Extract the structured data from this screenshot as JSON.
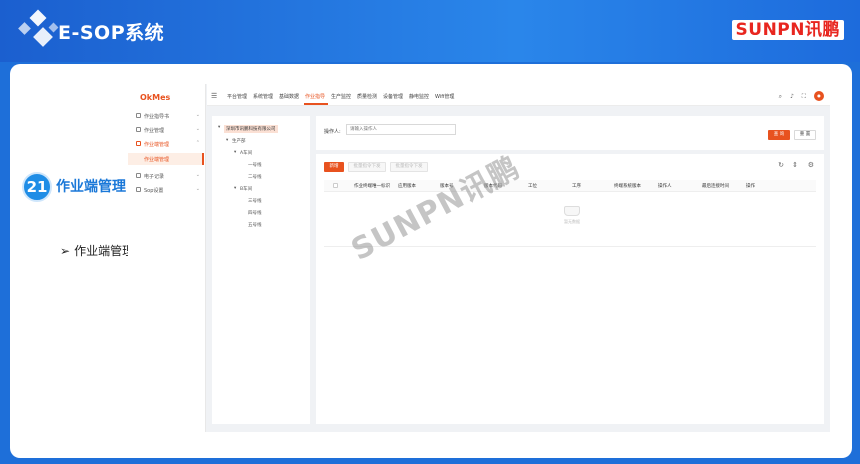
{
  "header": {
    "title": "E-SOP系统",
    "brand": "SUNPN讯鹏"
  },
  "section": {
    "number": "21",
    "title": "作业端管理",
    "bullet": "作业端管理"
  },
  "app": {
    "logo": "OkMes",
    "sidebar": [
      {
        "label": "作业指导书",
        "icon": "book-icon",
        "active": false
      },
      {
        "label": "作业管理",
        "icon": "list-icon",
        "active": false
      },
      {
        "label": "作业端管理",
        "icon": "device-icon",
        "active": true
      },
      {
        "label": "电子记录",
        "icon": "record-icon",
        "active": false
      },
      {
        "label": "Sop设置",
        "icon": "gear-icon",
        "active": false
      }
    ],
    "sidebar_sub": "作业端管理",
    "nav_tabs": [
      "平台管理",
      "系统管理",
      "基础数据",
      "作业指导",
      "生产监控",
      "质量检测",
      "设备管理",
      "静电监控",
      "Wifi管理"
    ],
    "nav_active": "作业指导",
    "tree": {
      "root": "深圳市讯鹏科技有限公司",
      "dept": "生产部",
      "workshop_a": "A车间",
      "lines_a": [
        "一号线",
        "二号线"
      ],
      "workshop_b": "B车间",
      "lines_b": [
        "三号线",
        "四号线",
        "五号线"
      ]
    },
    "filter": {
      "label": "操作人:",
      "placeholder": "请输入操作人",
      "search_btn": "查 询",
      "reset_btn": "重 置"
    },
    "toolbar": {
      "add_btn": "新增",
      "batch_issue": "批量指令下发",
      "batch_cancel": "批量指令下发"
    },
    "columns": [
      "作业终端唯一标识",
      "应用版本",
      "版本号",
      "版本代码",
      "工位",
      "工序",
      "终端系统版本",
      "操作人",
      "最后连接时间",
      "操作"
    ],
    "empty_text": "暂无数据"
  },
  "watermark": "SUNPN讯鹏"
}
